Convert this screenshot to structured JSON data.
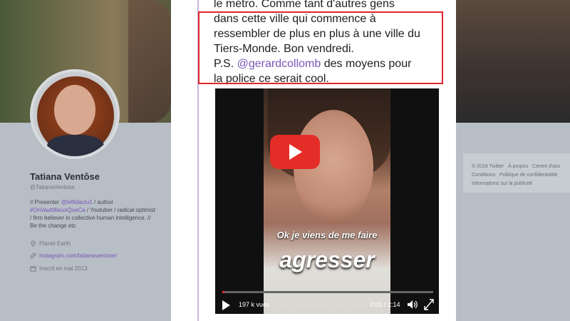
{
  "profile": {
    "name": "Tatiana Ventôse",
    "handle": "@TatianaVentose",
    "bio_parts": [
      {
        "text": "// Presenter ",
        "link": false
      },
      {
        "text": "@lefildactu1",
        "link": true
      },
      {
        "text": " / author ",
        "link": false
      },
      {
        "text": "#OnVautMieuxQueCa",
        "link": true
      },
      {
        "text": " / Youtuber / radical optimist / firm believer in collective human intelligence. // Be the change etc",
        "link": false
      }
    ],
    "location": "Planet Earth",
    "website": "instagram.com/tatianaventose/",
    "joined": "Inscrit en mai 2013",
    "icons": {
      "location": "location-pin-icon",
      "website": "link-icon",
      "joined": "calendar-icon"
    }
  },
  "footer": {
    "links": [
      "© 2018 Twitter",
      "À propos",
      "Centre d'ass",
      "Conditions",
      "Politique de confidentialité",
      "Informations sur la publicité"
    ]
  },
  "tweet": {
    "line_top": "le métro. Comme tant d'autres gens",
    "highlighted_lines": [
      "dans cette ville qui commence à",
      "ressembler de plus en plus à une ville du",
      "Tiers-Monde. Bon vendredi."
    ],
    "ps_prefix": "P.S. ",
    "ps_mention": "@gerardcollomb",
    "ps_rest": " des moyens pour",
    "line_last": "la police ce serait cool."
  },
  "video": {
    "caption_small": "Ok je viens de me faire",
    "caption_big": "agresser",
    "views": "197 k vues",
    "time": "0:01 / 2:14",
    "progress_fraction": 0.01,
    "accent": "#e52d27"
  },
  "colors": {
    "link": "#7a55b8",
    "highlight_border": "#e0262b"
  }
}
